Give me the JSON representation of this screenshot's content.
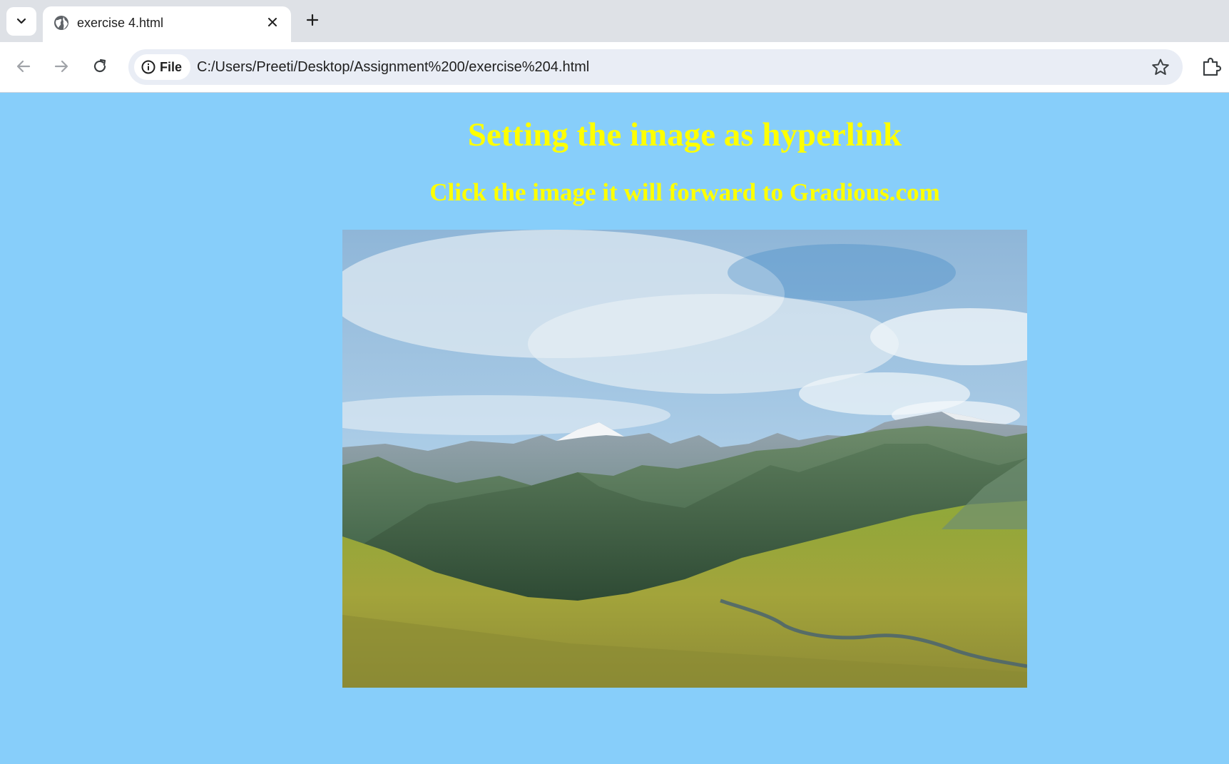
{
  "browser": {
    "tab": {
      "title": "exercise 4.html",
      "favicon": "globe-icon",
      "close_icon": "close-icon"
    },
    "tab_search_icon": "chevron-down-icon",
    "new_tab_icon": "plus-icon",
    "toolbar": {
      "back_icon": "arrow-left-icon",
      "forward_icon": "arrow-right-icon",
      "reload_icon": "reload-icon",
      "site_info_icon": "info-icon",
      "site_chip_label": "File",
      "url": "C:/Users/Preeti/Desktop/Assignment%200/exercise%204.html",
      "bookmark_icon": "star-icon",
      "extensions_icon": "puzzle-icon"
    }
  },
  "page": {
    "background": "#87cefa",
    "heading_color": "#ffff00",
    "heading": "Setting the image as hyperlink",
    "subheading": "Click the image it will forward to Gradious.com",
    "image_alt": "mountain landscape"
  }
}
